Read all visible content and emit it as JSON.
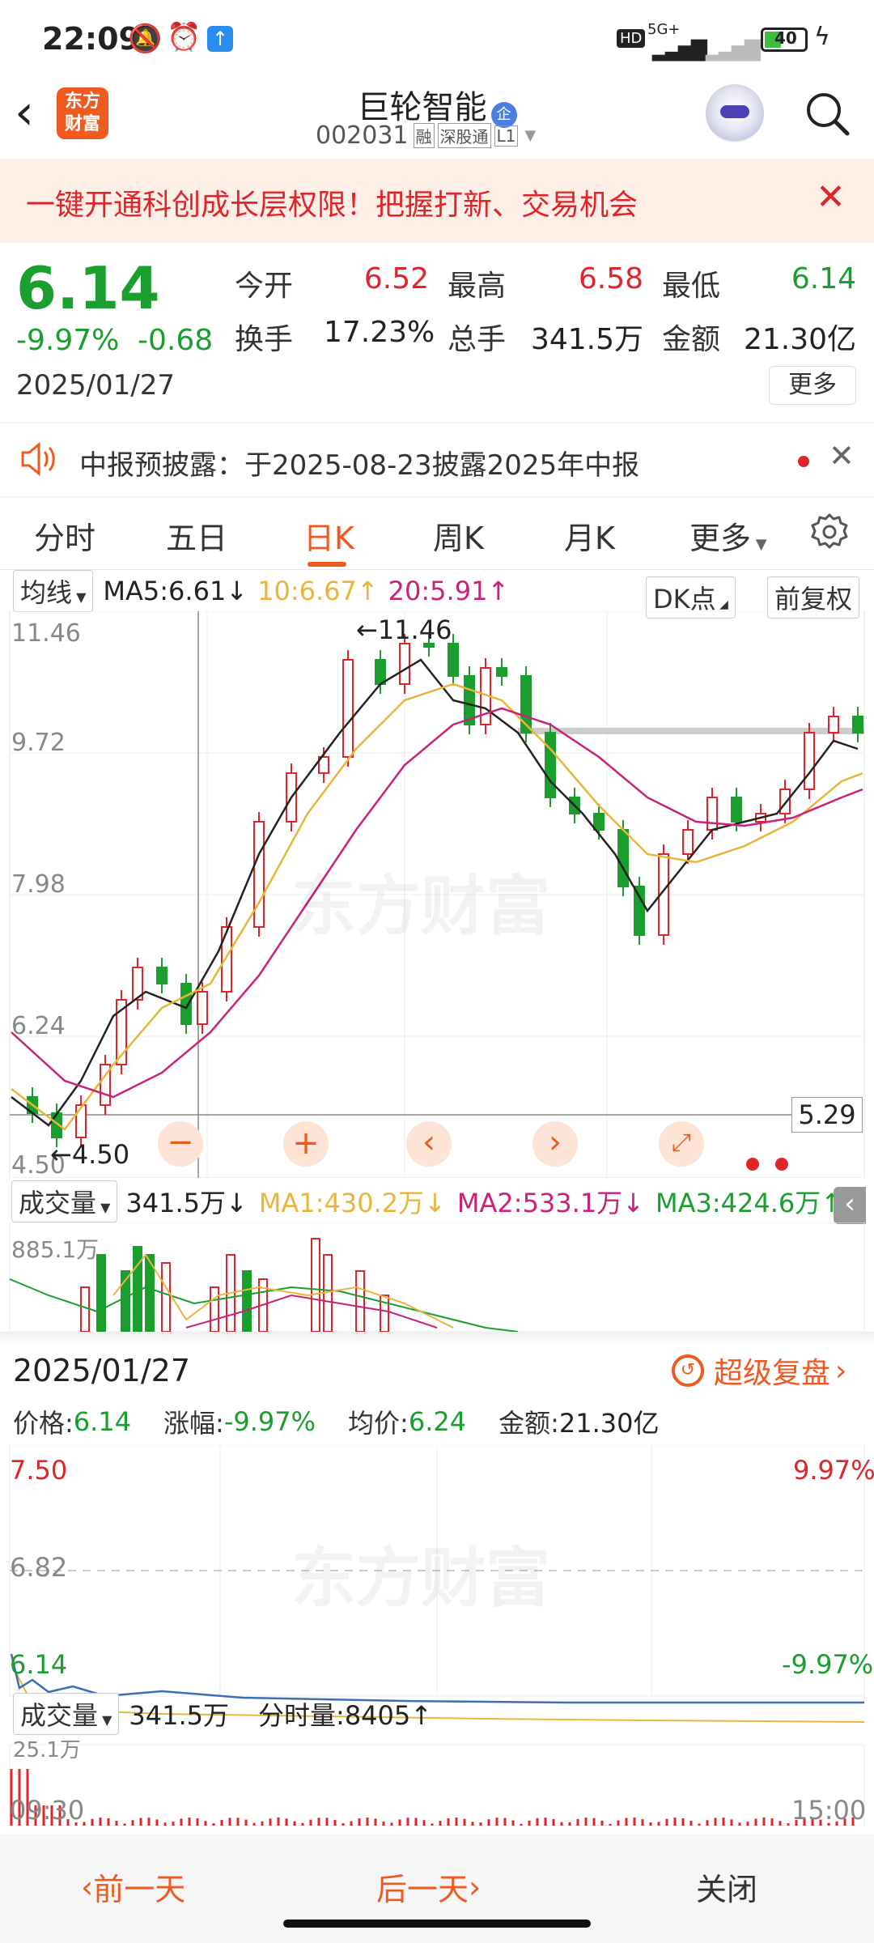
{
  "status": {
    "time": "22:09",
    "network": "5G+",
    "battery": "40"
  },
  "nav": {
    "logo_text": "东方财富",
    "title": "巨轮智能",
    "title_badge": "企",
    "code": "002031",
    "tag1": "融",
    "tag2": "深股通",
    "tag3": "L1"
  },
  "banner": {
    "text": "一键开通科创成长层权限！把握打新、交易机会"
  },
  "quote": {
    "price": "6.14",
    "change_pct": "-9.97%",
    "change": "-0.68",
    "date": "2025/01/27",
    "open_label": "今开",
    "open": "6.52",
    "high_label": "最高",
    "high": "6.58",
    "low_label": "最低",
    "low": "6.14",
    "turnover_label": "换手",
    "turnover": "17.23%",
    "volume_label": "总手",
    "volume": "341.5万",
    "amount_label": "金额",
    "amount": "21.30亿",
    "more": "更多"
  },
  "notice": {
    "text": "中报预披露：于2025-08-23披露2025年中报"
  },
  "tabs": [
    "分时",
    "五日",
    "日K",
    "周K",
    "月K",
    "更多"
  ],
  "active_tab": "日K",
  "indicator": {
    "ma_select": "均线",
    "ma5": "MA5:6.61↓",
    "ma10": "10:6.67↑",
    "ma20": "20:5.91↑",
    "dk": "DK点",
    "adjust": "前复权"
  },
  "chart_data": {
    "type": "candlestick",
    "y_ticks": [
      "11.46",
      "9.72",
      "7.98",
      "6.24",
      "4.50"
    ],
    "ylim": [
      4.5,
      11.46
    ],
    "max_marker": "←11.46",
    "min_marker": "←4.50",
    "last_price_tag": "5.29",
    "colors": {
      "up": "#e0242a",
      "down": "#1a9e2e",
      "ma5": "#222222",
      "ma10": "#e9b63a",
      "ma20": "#c8227a"
    },
    "watermark": "东方财富"
  },
  "volume": {
    "select": "成交量",
    "value": "341.5万↓",
    "ma1": "MA1:430.2万↓",
    "ma2": "MA2:533.1万↓",
    "ma3": "MA3:424.6万↑",
    "max_tick": "885.1万"
  },
  "detail": {
    "date": "2025/01/27",
    "link": "超级复盘",
    "price_label": "价格:",
    "price": "6.14",
    "pct_label": "涨幅:",
    "pct": "-9.97%",
    "avg_label": "均价:",
    "avg": "6.24",
    "amt_label": "金额:",
    "amt": "21.30亿",
    "y_top": "7.50",
    "y_mid": "6.82",
    "y_bot": "6.14",
    "pct_top": "9.97%",
    "pct_bot": "-9.97%",
    "vol_select": "成交量",
    "vol_value": "341.5万",
    "tick_vol": "分时量:8405↑",
    "vol_max": "25.1万",
    "time_start": "09:30",
    "time_end": "15:00",
    "watermark": "东方财富"
  },
  "bottom": {
    "prev": "前一天",
    "next": "后一天",
    "close": "关闭"
  }
}
